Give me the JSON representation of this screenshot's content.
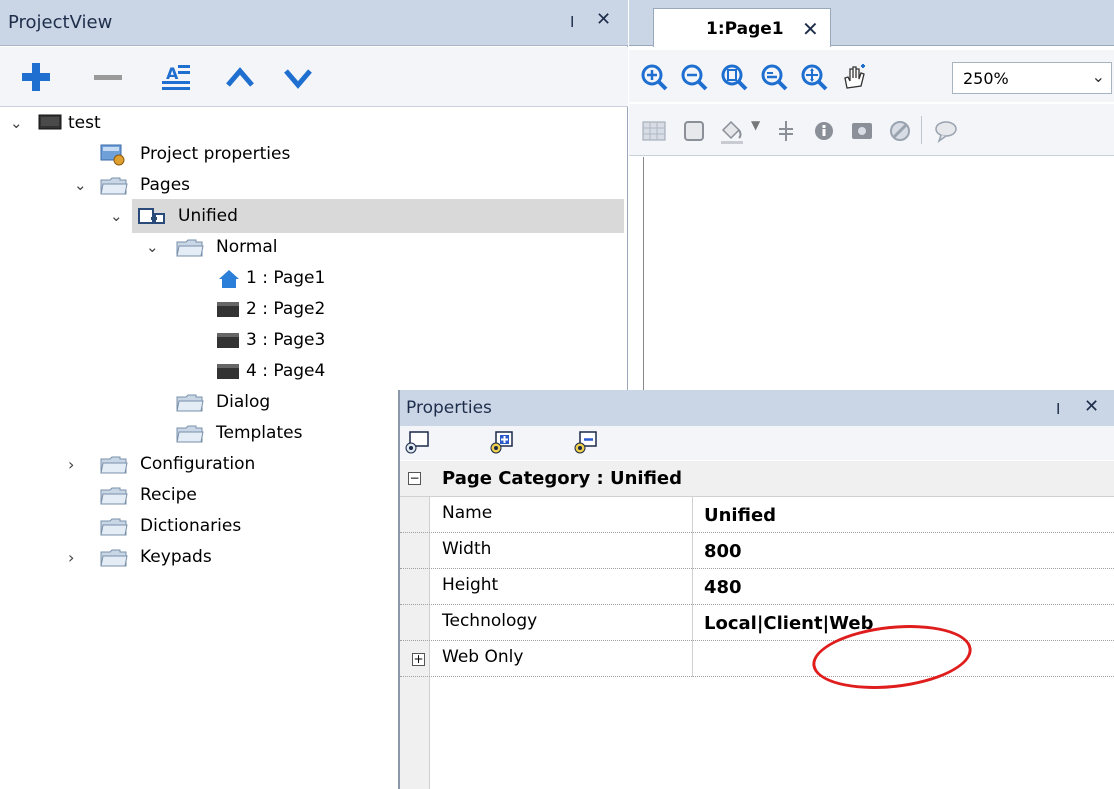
{
  "project_view": {
    "title": "ProjectView",
    "pin": "ⵏ",
    "close": "✕",
    "toolbar": [
      "add-icon",
      "remove-icon",
      "rename-icon",
      "move-up-icon",
      "move-down-icon"
    ],
    "tree": {
      "root": "test",
      "project_properties": "Project properties",
      "pages": "Pages",
      "unified": "Unified",
      "normal": "Normal",
      "page1": "1 : Page1",
      "page2": "2 : Page2",
      "page3": "3 : Page3",
      "page4": "4 : Page4",
      "dialog": "Dialog",
      "templates": "Templates",
      "configuration": "Configuration",
      "recipe": "Recipe",
      "dictionaries": "Dictionaries",
      "keypads": "Keypads"
    }
  },
  "editor": {
    "tab_label": "1:Page1",
    "tab_close": "✕",
    "zoom_value": "250%"
  },
  "properties": {
    "title": "Properties",
    "pin": "ⵏ",
    "close": "✕",
    "category": "Page Category : Unified",
    "rows": [
      {
        "name": "Name",
        "value": "Unified"
      },
      {
        "name": "Width",
        "value": "800"
      },
      {
        "name": "Height",
        "value": "480"
      },
      {
        "name": "Technology",
        "value": "Local|Client|Web"
      },
      {
        "name": "Web Only",
        "value": ""
      }
    ]
  },
  "colors": {
    "panel_header": "#cad5e6",
    "accent_blue": "#1f6fd0",
    "highlight_circle": "#e01d1d"
  }
}
